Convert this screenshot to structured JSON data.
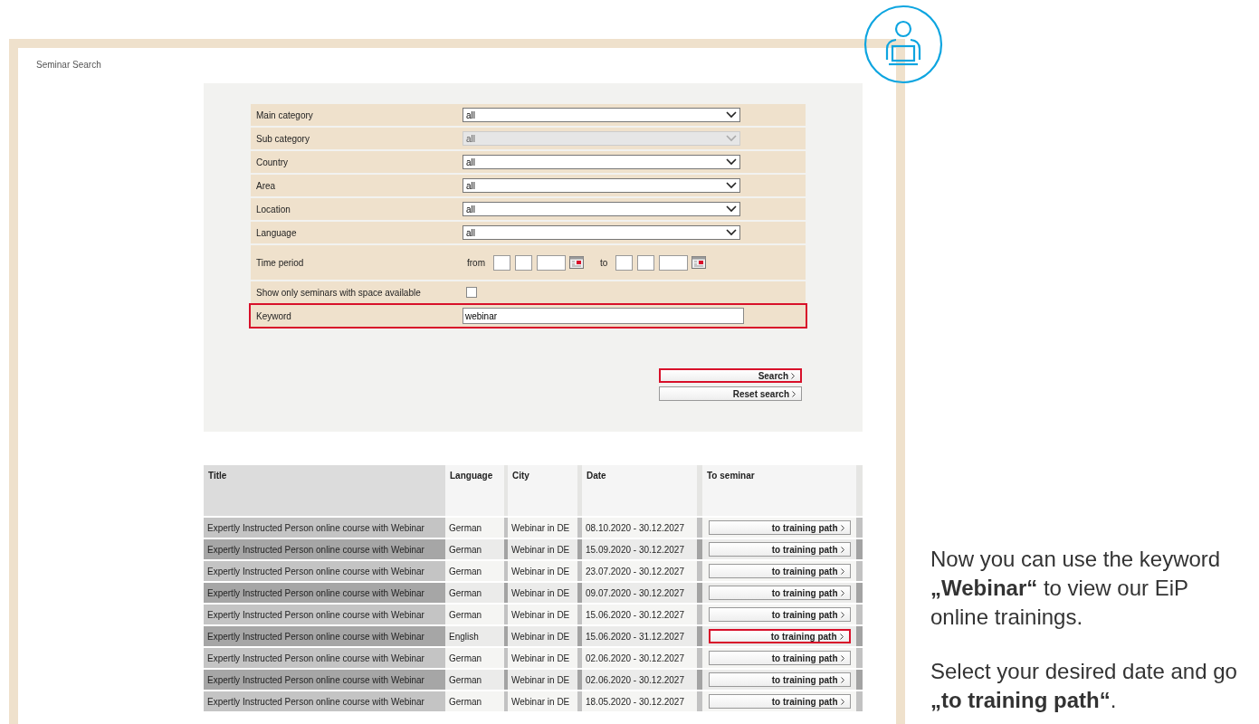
{
  "page_title": "Seminar Search",
  "form": {
    "fields": [
      {
        "kind": "select",
        "label": "Main category",
        "value": "all",
        "disabled": false,
        "highlighted": false
      },
      {
        "kind": "select",
        "label": "Sub category",
        "value": "all",
        "disabled": true,
        "highlighted": false
      },
      {
        "kind": "select",
        "label": "Country",
        "value": "all",
        "disabled": false,
        "highlighted": false
      },
      {
        "kind": "select",
        "label": "Area",
        "value": "all",
        "disabled": false,
        "highlighted": false
      },
      {
        "kind": "select",
        "label": "Location",
        "value": "all",
        "disabled": false,
        "highlighted": false
      },
      {
        "kind": "select",
        "label": "Language",
        "value": "all",
        "disabled": false,
        "highlighted": false
      },
      {
        "kind": "date_range",
        "label": "Time period",
        "from_label": "from",
        "to_label": "to",
        "highlighted": false
      },
      {
        "kind": "checkbox",
        "label": "Show only seminars with space available",
        "checked": false,
        "highlighted": false
      },
      {
        "kind": "text",
        "label": "Keyword",
        "value": "webinar",
        "highlighted": true
      }
    ],
    "buttons": [
      {
        "label": "Search",
        "highlighted": true
      },
      {
        "label": "Reset search",
        "highlighted": false
      }
    ]
  },
  "table": {
    "columns": [
      "Title",
      "Language",
      "City",
      "Date",
      "To seminar"
    ],
    "rows": [
      {
        "title": "Expertly Instructed Person online course with Webinar",
        "language": "German",
        "city": "Webinar in DE",
        "date": "08.10.2020 - 30.12.2027",
        "button": "to training path",
        "highlighted": false
      },
      {
        "title": "Expertly Instructed Person online course with Webinar",
        "language": "German",
        "city": "Webinar in DE",
        "date": "15.09.2020 - 30.12.2027",
        "button": "to training path",
        "highlighted": false
      },
      {
        "title": "Expertly Instructed Person online course with Webinar",
        "language": "German",
        "city": "Webinar in DE",
        "date": "23.07.2020 - 30.12.2027",
        "button": "to training path",
        "highlighted": false
      },
      {
        "title": "Expertly Instructed Person online course with Webinar",
        "language": "German",
        "city": "Webinar in DE",
        "date": "09.07.2020 - 30.12.2027",
        "button": "to training path",
        "highlighted": false
      },
      {
        "title": "Expertly Instructed Person online course with Webinar",
        "language": "German",
        "city": "Webinar in DE",
        "date": "15.06.2020 - 30.12.2027",
        "button": "to training path",
        "highlighted": false
      },
      {
        "title": "Expertly Instructed Person online course with Webinar",
        "language": "English",
        "city": "Webinar in DE",
        "date": "15.06.2020 - 31.12.2027",
        "button": "to training path",
        "highlighted": true
      },
      {
        "title": "Expertly Instructed Person online course with Webinar",
        "language": "German",
        "city": "Webinar in DE",
        "date": "02.06.2020 - 30.12.2027",
        "button": "to training path",
        "highlighted": false
      },
      {
        "title": "Expertly Instructed Person online course with Webinar",
        "language": "German",
        "city": "Webinar in DE",
        "date": "02.06.2020 - 30.12.2027",
        "button": "to training path",
        "highlighted": false
      },
      {
        "title": "Expertly Instructed Person online course with Webinar",
        "language": "German",
        "city": "Webinar in DE",
        "date": "18.05.2020 - 30.12.2027",
        "button": "to training path",
        "highlighted": false
      }
    ]
  },
  "side_text": [
    "Now you can use the keyword **„Webinar“** to view our EiP online trainings.",
    "Select your desired date and go **„to training path“**."
  ]
}
